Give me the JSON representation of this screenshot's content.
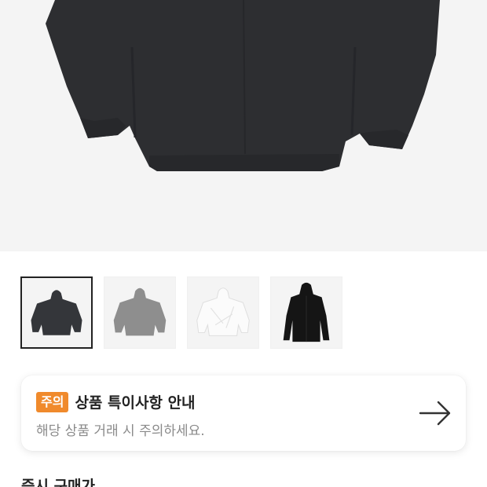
{
  "product": {
    "main_image_icon": "black-hoodie-image",
    "colors": {
      "hero_bg": "#f4f4f4",
      "garment": "#2d2e31"
    }
  },
  "thumbnails": [
    {
      "name": "thumb-black",
      "icon": "black-hoodie-thumbnail",
      "color": "#34363a",
      "selected": true
    },
    {
      "name": "thumb-gray",
      "icon": "gray-hoodie-thumbnail",
      "color": "#8e8e8e",
      "selected": false
    },
    {
      "name": "thumb-white",
      "icon": "white-hoodie-thumbnail",
      "color": "#f7f7f7",
      "selected": false
    },
    {
      "name": "thumb-black-front",
      "icon": "black-hoodie-front-thumbnail",
      "color": "#151515",
      "selected": false
    }
  ],
  "notice": {
    "badge": "주의",
    "title": "상품 특이사항 안내",
    "subtitle": "해당 상품 거래 시 주의하세요.",
    "arrow_icon": "arrow-right-icon",
    "badge_color": "#f08a2c"
  },
  "section": {
    "label": "즉시 구매가"
  }
}
